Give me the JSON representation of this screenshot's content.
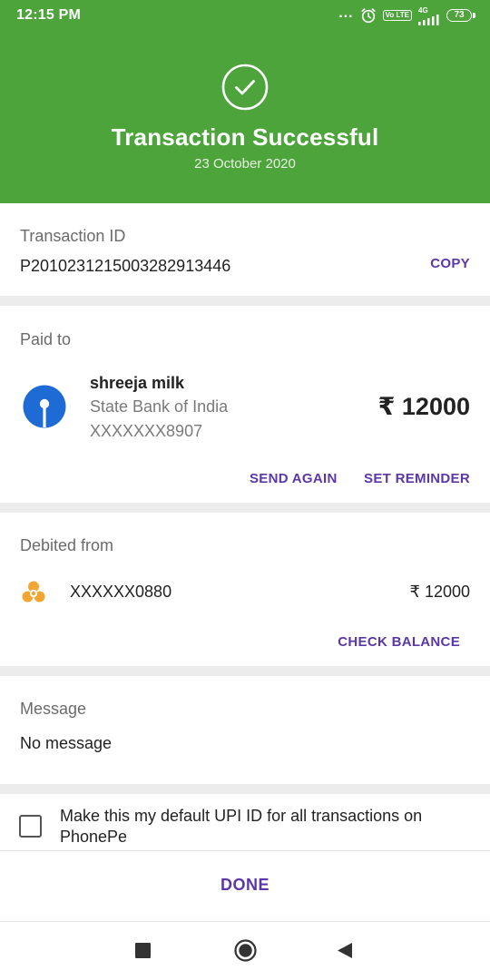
{
  "status_bar": {
    "time": "12:15 PM",
    "dots": "...",
    "volte": "Vo LTE",
    "network": "4G",
    "battery": "73"
  },
  "header": {
    "title": "Transaction Successful",
    "date": "23 October 2020",
    "background_color": "#4ca43b"
  },
  "transaction": {
    "label": "Transaction ID",
    "id": "P2010231215003282913446",
    "copy_label": "COPY"
  },
  "paid_to": {
    "label": "Paid to",
    "name": "shreeja milk",
    "bank": "State Bank of India",
    "account": "XXXXXXX8907",
    "amount": "₹ 12000",
    "send_again_label": "SEND AGAIN",
    "set_reminder_label": "SET REMINDER",
    "logo_icon": "sbi-logo-icon"
  },
  "debited_from": {
    "label": "Debited from",
    "account": "XXXXXX0880",
    "amount": "₹ 12000",
    "check_balance_label": "CHECK BALANCE",
    "logo_icon": "bank-logo-icon"
  },
  "message": {
    "label": "Message",
    "text": "No message"
  },
  "default_upi": {
    "label": "Make this my default UPI ID for all transactions on PhonePe",
    "checked": false
  },
  "done_label": "DONE",
  "accent_color": "#5b37a8"
}
